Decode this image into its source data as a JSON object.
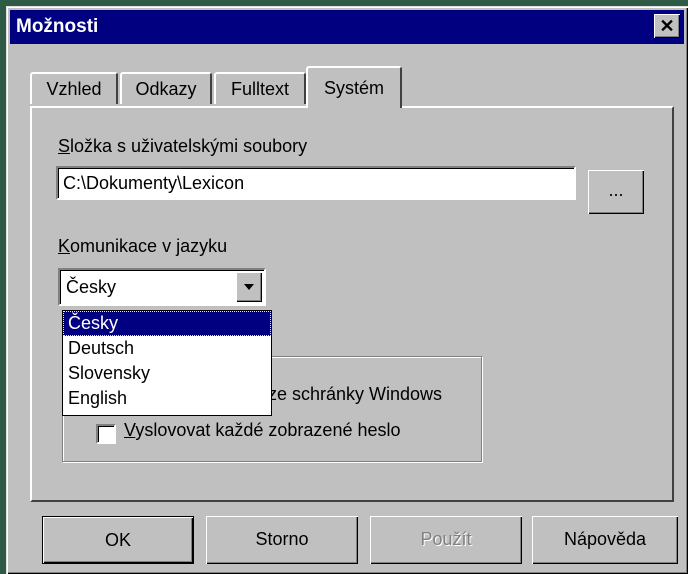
{
  "window": {
    "title": "Možnosti",
    "close_glyph": "✕"
  },
  "tabs": [
    {
      "label": "Vzhled",
      "active": false
    },
    {
      "label": "Odkazy",
      "active": false
    },
    {
      "label": "Fulltext",
      "active": false
    },
    {
      "label": "Systém",
      "active": true
    }
  ],
  "system": {
    "folder_label_key": "S",
    "folder_label_rest": "ložka s uživatelskými soubory",
    "folder_value": "C:\\Dokumenty\\Lexicon",
    "browse_label": "...",
    "language_label_key": "K",
    "language_label_rest": "omunikace v jazyku",
    "language_selected": "Česky",
    "language_options": [
      "Česky",
      "Deutsch",
      "Slovensky",
      "English"
    ],
    "checkbox1_label_visible": "ze schránky Windows",
    "checkbox1_checked": false,
    "checkbox2_label_key": "V",
    "checkbox2_label_rest": "yslovovat každé zobrazené heslo",
    "checkbox2_checked": false
  },
  "buttons": {
    "ok": "OK",
    "cancel": "Storno",
    "apply": "Použít",
    "help": "Nápověda"
  },
  "icons": {
    "dropdown_arrow": "chevron-down-icon",
    "close": "close-icon"
  },
  "colors": {
    "titlebar": "#000080",
    "face": "#c0c0c0",
    "selection": "#000080"
  }
}
